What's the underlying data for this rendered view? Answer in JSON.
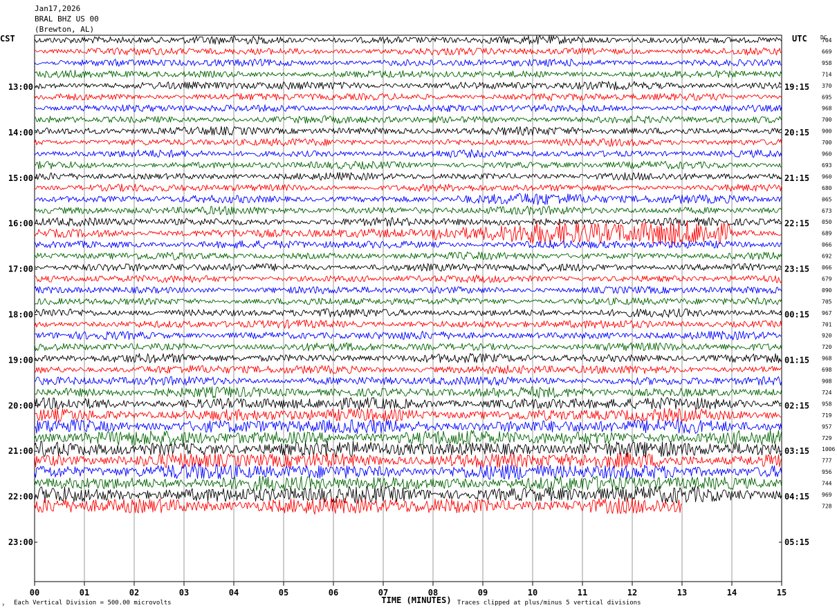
{
  "header": {
    "date": "Jan17,2026",
    "station": "BRAL BHZ US 00",
    "location": "(Brewton, AL)"
  },
  "labels": {
    "left_tz": "CST",
    "right_tz": "UTC",
    "dc": "DC"
  },
  "footer": {
    "scale_note": "Each Vertical Division =  500.00 microvolts",
    "clip_note": "Traces clipped at plus/minus 5 vertical divisions",
    "corner_mark": "›"
  },
  "chart_data": {
    "type": "line",
    "subtype": "helicorder",
    "title": "Jan17,2026 BRAL BHZ US 00 (Brewton, AL)",
    "xlabel": "TIME (MINUTES)",
    "ylabel": "",
    "x_ticks": [
      "00",
      "01",
      "02",
      "03",
      "04",
      "05",
      "06",
      "07",
      "08",
      "09",
      "10",
      "11",
      "12",
      "13",
      "14",
      "15"
    ],
    "xlim": [
      0,
      15
    ],
    "left_hour_labels": [
      "13:00",
      "14:00",
      "15:00",
      "16:00",
      "17:00",
      "18:00",
      "19:00",
      "20:00",
      "21:00",
      "22:00",
      "23:00"
    ],
    "right_hour_labels": [
      "19:15",
      "20:15",
      "21:15",
      "22:15",
      "23:15",
      "00:15",
      "01:15",
      "02:15",
      "03:15",
      "04:15",
      "05:15"
    ],
    "trace_colors": [
      "#000000",
      "#ff0000",
      "#0000ff",
      "#006400"
    ],
    "dc_offsets": [
      "704",
      "669",
      "958",
      "714",
      "370",
      "695",
      "968",
      "700",
      "900",
      "700",
      "960",
      "693",
      "960",
      "680",
      "065",
      "673",
      "050",
      "689",
      "066",
      "692",
      "066",
      "679",
      "090",
      "705",
      "967",
      "701",
      "920",
      "720",
      "968",
      "698",
      "908",
      "724",
      "958",
      "719",
      "957",
      "729",
      "1006",
      "777",
      "956",
      "744",
      "969",
      "728"
    ],
    "trace_amplitude": [
      0.55,
      0.5,
      0.5,
      0.5,
      0.55,
      0.5,
      0.5,
      0.5,
      0.55,
      0.5,
      0.5,
      0.5,
      0.5,
      0.5,
      0.5,
      0.55,
      0.55,
      0.6,
      0.55,
      0.5,
      0.55,
      0.5,
      0.5,
      0.5,
      0.55,
      0.55,
      0.55,
      0.55,
      0.6,
      0.6,
      0.6,
      0.7,
      0.8,
      0.85,
      0.95,
      1.0,
      1.05,
      1.05,
      1.05,
      1.0,
      1.1,
      1.1
    ],
    "trace_end_minute": 13.0,
    "event_bursts": [
      {
        "trace": 14,
        "start_minute": 8.5,
        "end_minute": 14.5,
        "amplitude": 1.1
      },
      {
        "trace": 17,
        "start_minute": 8.0,
        "end_minute": 14.0,
        "amplitude": 2.0
      }
    ],
    "vertical_division_microvolts": 500.0,
    "clip_divisions": 5,
    "grid": true
  }
}
